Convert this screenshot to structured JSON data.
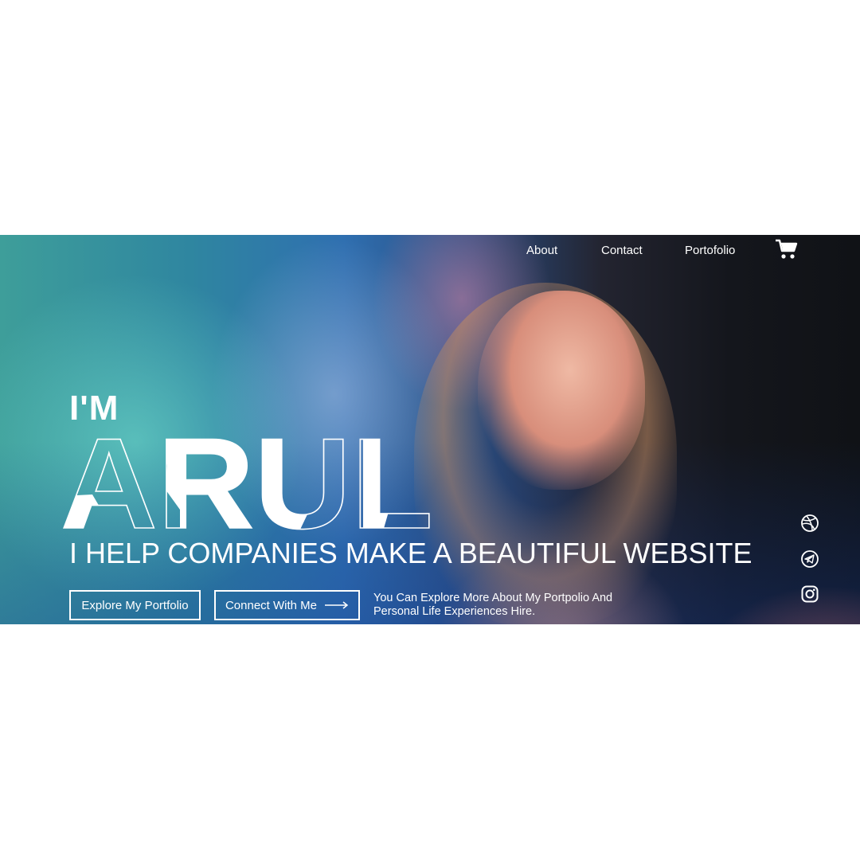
{
  "nav": {
    "items": [
      {
        "label": "About"
      },
      {
        "label": "Contact"
      },
      {
        "label": "Portofolio"
      }
    ],
    "cart_icon": "shopping-cart-icon"
  },
  "hero": {
    "intro": "I'M",
    "name": "ARUL",
    "tagline": "I HELP COMPANIES MAKE A BEAUTIFUL WEBSITE",
    "buttons": {
      "explore": "Explore My Portfolio",
      "connect": "Connect With Me"
    },
    "description": "You Can Explore More About My Portpolio And Personal Life Experiences Hire."
  },
  "social": [
    "dribbble-icon",
    "telegram-icon",
    "instagram-icon"
  ],
  "colors": {
    "text": "#ffffff",
    "page_background": "#ffffff"
  }
}
